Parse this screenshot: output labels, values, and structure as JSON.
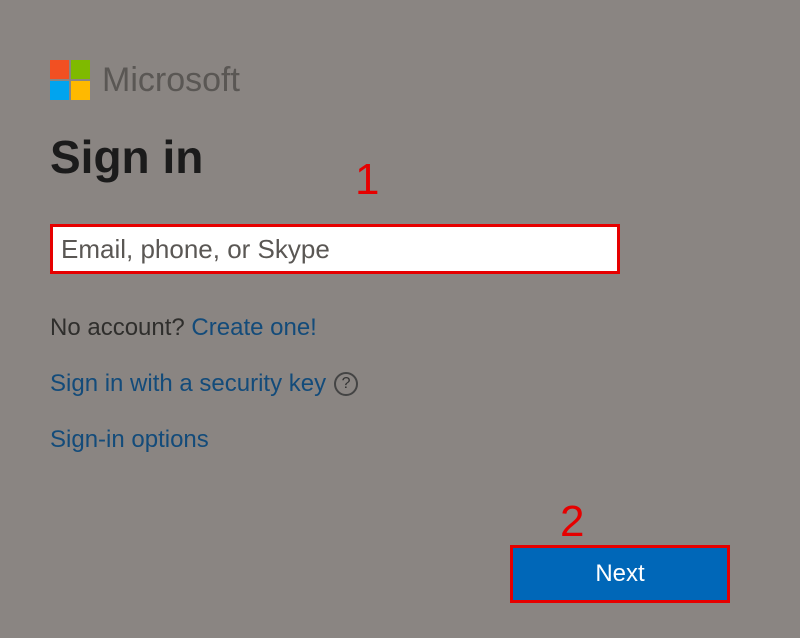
{
  "brand": "Microsoft",
  "heading": "Sign in",
  "input": {
    "placeholder": "Email, phone, or Skype",
    "value": ""
  },
  "noAccount": {
    "prefix": "No account? ",
    "link": "Create one!"
  },
  "securityKey": {
    "text": "Sign in with a security key",
    "helpGlyph": "?"
  },
  "signinOptions": "Sign-in options",
  "nextButton": "Next",
  "annotations": {
    "one": "1",
    "two": "2"
  },
  "logoColors": {
    "topLeft": "#f25022",
    "topRight": "#7fba00",
    "bottomLeft": "#00a4ef",
    "bottomRight": "#ffb900"
  },
  "annotationColor": "#e60000",
  "primaryButtonColor": "#0067b8"
}
